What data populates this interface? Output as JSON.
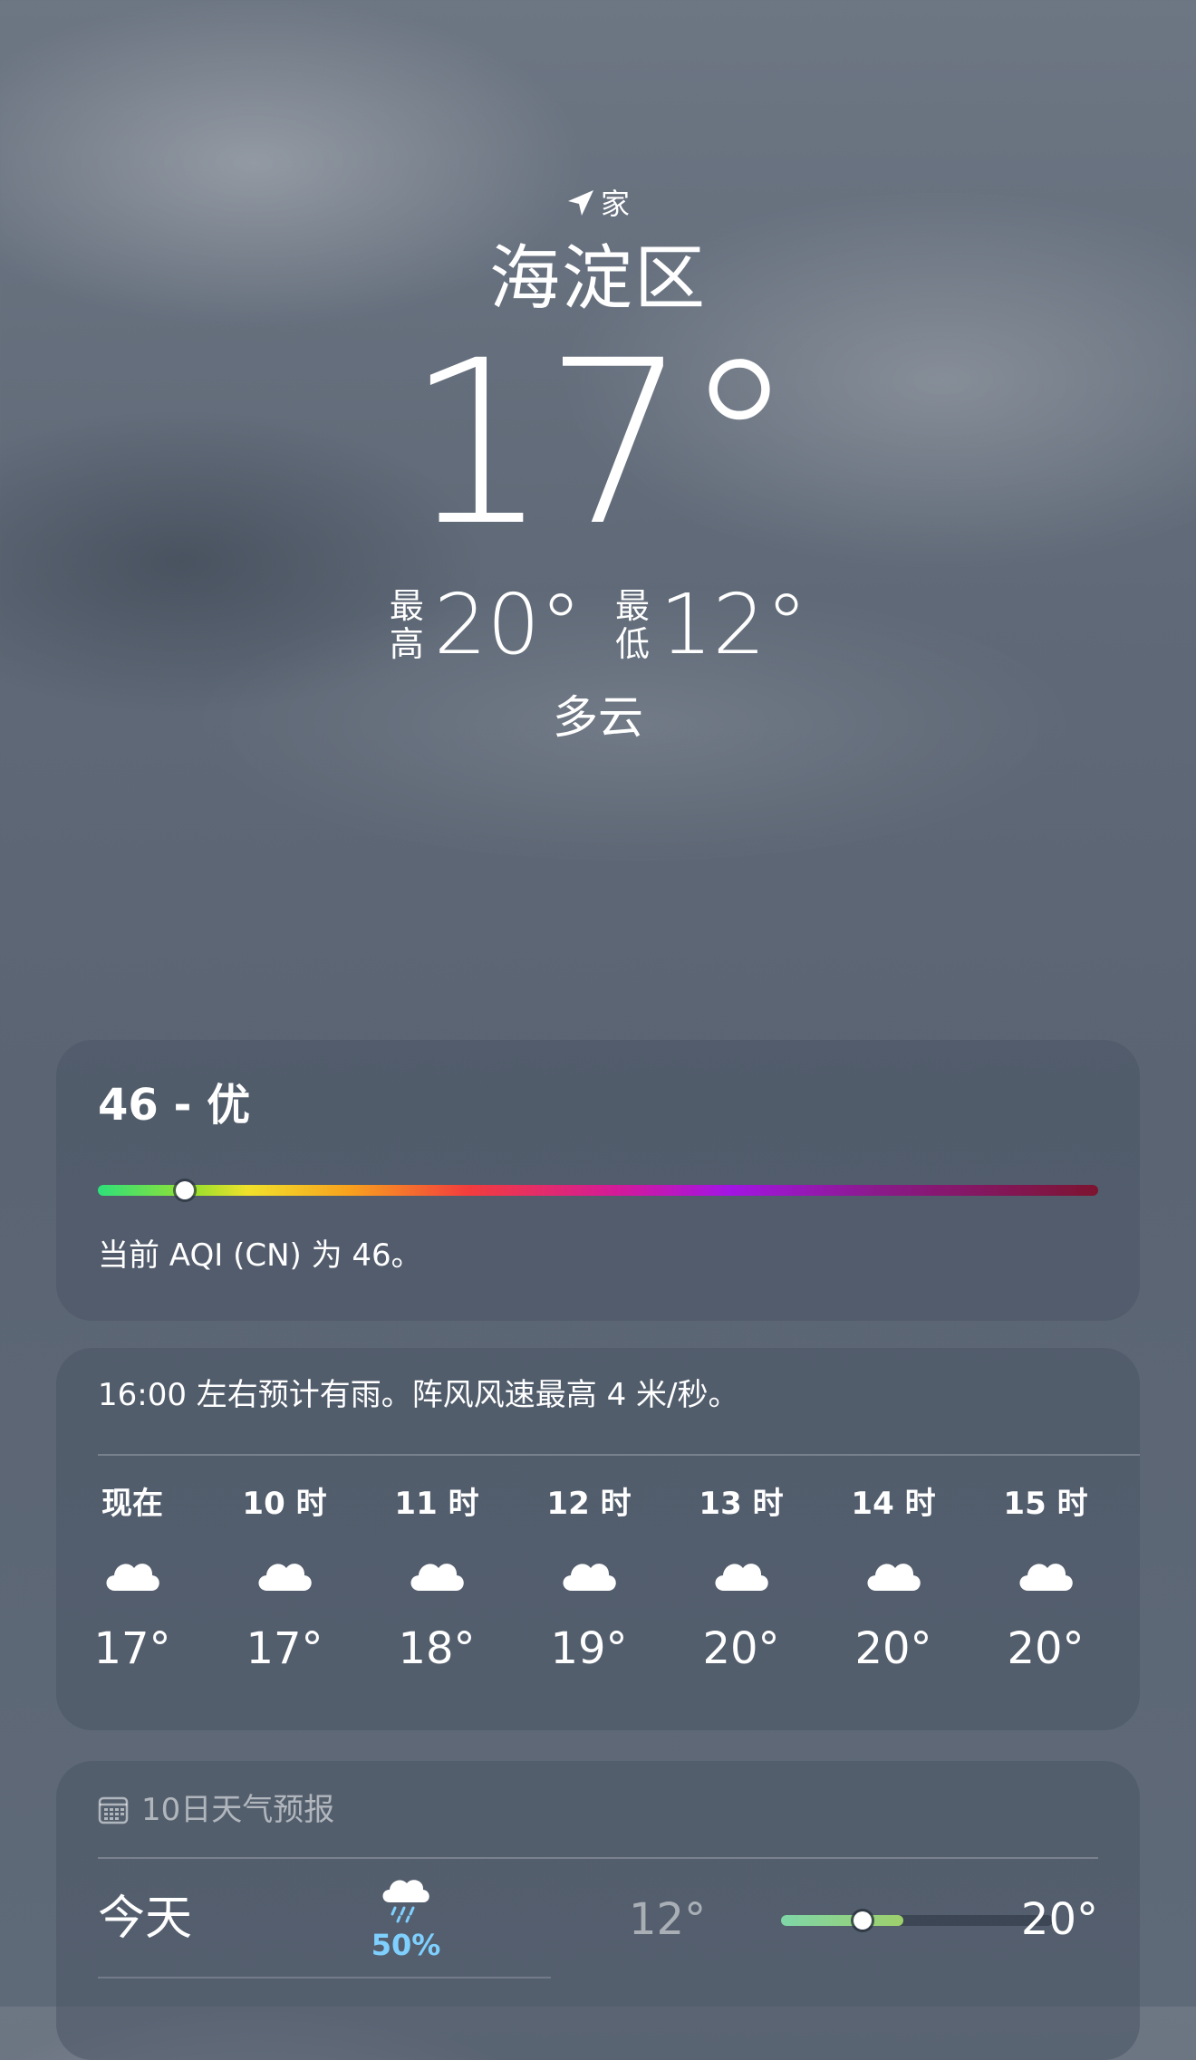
{
  "location": {
    "label": "家",
    "city": "海淀区"
  },
  "current": {
    "temperature": "17°",
    "high_label": "最高",
    "high": "20°",
    "low_label": "最低",
    "low": "12°",
    "condition": "多云"
  },
  "aqi": {
    "title": "46 - 优",
    "description": "当前 AQI (CN) 为 46。",
    "value": 46,
    "scale_max": 500
  },
  "hourly": {
    "summary": "16:00 左右预计有雨。阵风风速最高 4 米/秒。",
    "items": [
      {
        "time": "现在",
        "icon": "cloud-icon",
        "temp": "17°"
      },
      {
        "time": "10 时",
        "icon": "cloud-icon",
        "temp": "17°"
      },
      {
        "time": "11 时",
        "icon": "cloud-icon",
        "temp": "18°"
      },
      {
        "time": "12 时",
        "icon": "cloud-icon",
        "temp": "19°"
      },
      {
        "time": "13 时",
        "icon": "cloud-icon",
        "temp": "20°"
      },
      {
        "time": "14 时",
        "icon": "cloud-icon",
        "temp": "20°"
      },
      {
        "time": "15 时",
        "icon": "cloud-icon",
        "temp": "20°"
      }
    ]
  },
  "forecast": {
    "header": "10日天气预报",
    "days": [
      {
        "day": "今天",
        "icon": "cloud-rain-icon",
        "precip": "50%",
        "low": "12°",
        "high": "20°",
        "range_start": 0.0,
        "range_end": 0.45,
        "current_marker": 0.3
      }
    ]
  },
  "colors": {
    "precip": "#7fd0ff"
  }
}
